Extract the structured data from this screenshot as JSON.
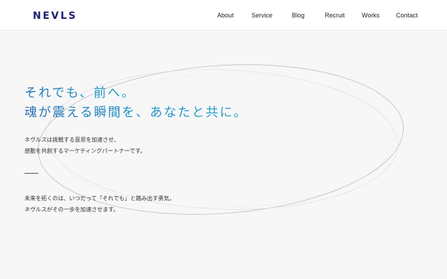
{
  "header": {
    "logo": "NEVLS",
    "nav": [
      "About",
      "Service",
      "Blog",
      "Recruit",
      "Works",
      "Contact"
    ]
  },
  "hero": {
    "headline_line1": "それでも、前へ。",
    "headline_line2": "魂が震える瞬間を、あなたと共に。",
    "intro_line1": "ネヴルスは挑戦する意思を加速させ、",
    "intro_line2": "感動を共創するマーケティングパートナーです。",
    "outro_line1": "未来を拓くのは、いつだって「それでも」と踏み出す勇気。",
    "outro_line2": "ネヴルスがその一歩を加速させます。"
  },
  "colors": {
    "logo": "#1f1f6e",
    "headline_gradient_start": "#2a6fb5",
    "headline_gradient_end": "#1fa2c9",
    "background": "#f7f7f7",
    "text": "#333333"
  }
}
